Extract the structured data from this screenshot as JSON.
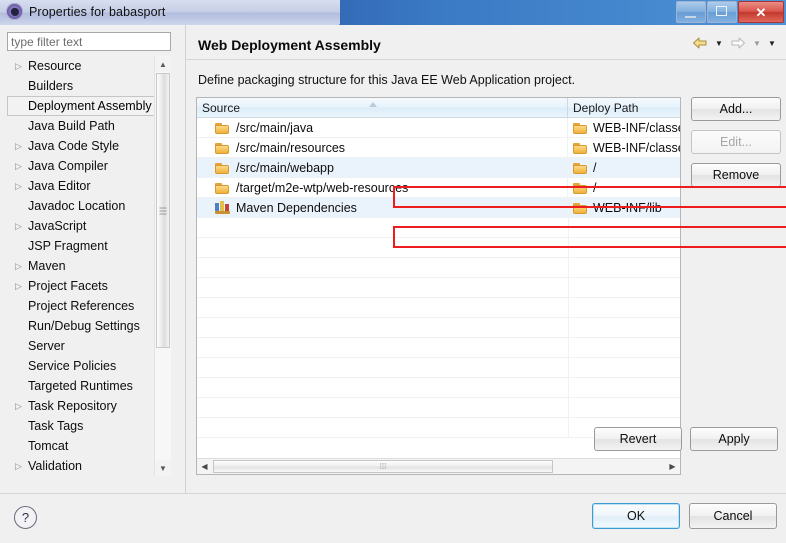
{
  "window": {
    "title": "Properties for babasport",
    "app_icon": "eclipse-icon",
    "controls": {
      "minimize": "minimize-icon",
      "maximize": "maximize-icon",
      "close": "✕"
    }
  },
  "sidebar": {
    "filter": {
      "placeholder": "type filter text",
      "value": ""
    },
    "items": [
      {
        "label": "Resource",
        "expandable": true,
        "selected": false
      },
      {
        "label": "Builders",
        "expandable": false,
        "selected": false
      },
      {
        "label": "Deployment Assembly",
        "expandable": false,
        "selected": true
      },
      {
        "label": "Java Build Path",
        "expandable": false,
        "selected": false
      },
      {
        "label": "Java Code Style",
        "expandable": true,
        "selected": false
      },
      {
        "label": "Java Compiler",
        "expandable": true,
        "selected": false
      },
      {
        "label": "Java Editor",
        "expandable": true,
        "selected": false
      },
      {
        "label": "Javadoc Location",
        "expandable": false,
        "selected": false
      },
      {
        "label": "JavaScript",
        "expandable": true,
        "selected": false
      },
      {
        "label": "JSP Fragment",
        "expandable": false,
        "selected": false
      },
      {
        "label": "Maven",
        "expandable": true,
        "selected": false
      },
      {
        "label": "Project Facets",
        "expandable": true,
        "selected": false
      },
      {
        "label": "Project References",
        "expandable": false,
        "selected": false
      },
      {
        "label": "Run/Debug Settings",
        "expandable": false,
        "selected": false
      },
      {
        "label": "Server",
        "expandable": false,
        "selected": false
      },
      {
        "label": "Service Policies",
        "expandable": false,
        "selected": false
      },
      {
        "label": "Targeted Runtimes",
        "expandable": false,
        "selected": false
      },
      {
        "label": "Task Repository",
        "expandable": true,
        "selected": false
      },
      {
        "label": "Task Tags",
        "expandable": false,
        "selected": false
      },
      {
        "label": "Tomcat",
        "expandable": false,
        "selected": false
      },
      {
        "label": "Validation",
        "expandable": true,
        "selected": false
      }
    ]
  },
  "page": {
    "title": "Web Deployment Assembly",
    "description": "Define packaging structure for this Java EE Web Application project.",
    "nav": {
      "back": "back-arrow-icon",
      "back_menu": "▼",
      "forward": "forward-arrow-icon",
      "forward_menu": "▼",
      "view_menu": "▼"
    }
  },
  "table": {
    "columns": [
      {
        "label": "Source"
      },
      {
        "label": "Deploy Path"
      }
    ],
    "sort_indicator": "ascending",
    "rows": [
      {
        "source": "/src/main/java",
        "source_icon": "folder-icon",
        "deploy": "WEB-INF/classe",
        "deploy_icon": "folder-icon",
        "highlighted": false
      },
      {
        "source": "/src/main/resources",
        "source_icon": "folder-icon",
        "deploy": "WEB-INF/classe",
        "deploy_icon": "folder-icon",
        "highlighted": false
      },
      {
        "source": "/src/main/webapp",
        "source_icon": "folder-icon",
        "deploy": "/",
        "deploy_icon": "folder-icon",
        "highlighted": true
      },
      {
        "source": "/target/m2e-wtp/web-resources",
        "source_icon": "folder-icon",
        "deploy": "/",
        "deploy_icon": "folder-icon",
        "highlighted": false
      },
      {
        "source": "Maven Dependencies",
        "source_icon": "library-icon",
        "deploy": "WEB-INF/lib",
        "deploy_icon": "folder-icon",
        "highlighted": true
      }
    ],
    "empty_row_count": 11,
    "hscroll": {
      "left_arrow": "◀",
      "right_arrow": "▶",
      "grip": "⁞⁞⁞"
    }
  },
  "annotations": [
    {
      "name": "webapp-row-highlight",
      "color": "#ee1c1c"
    },
    {
      "name": "maven-dependencies-row-highlight",
      "color": "#ee1c1c"
    }
  ],
  "buttons": {
    "add": {
      "label": "Add...",
      "disabled": false
    },
    "edit": {
      "label": "Edit...",
      "disabled": true
    },
    "remove": {
      "label": "Remove",
      "disabled": false
    },
    "revert": {
      "label": "Revert",
      "disabled": false
    },
    "apply": {
      "label": "Apply",
      "disabled": false
    }
  },
  "footer": {
    "help": "?",
    "ok": "OK",
    "cancel": "Cancel"
  },
  "scrollbars": {
    "tree_vertical": {
      "up": "▲",
      "down": "▼",
      "grip": ""
    },
    "tree_horizontal": {
      "left": "◀",
      "right": "▶",
      "grip": "⁞⁞⁞"
    }
  }
}
